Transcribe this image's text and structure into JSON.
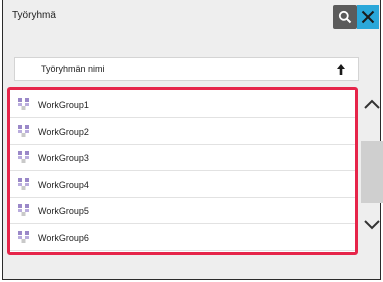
{
  "title": "Työryhmä",
  "sort_column_label": "Työryhmän nimi",
  "workgroups": [
    "WorkGroup1",
    "WorkGroup2",
    "WorkGroup3",
    "WorkGroup4",
    "WorkGroup5",
    "WorkGroup6"
  ],
  "colors": {
    "accent": "#e6254a",
    "close": "#2aa7d9",
    "search": "#5b5b5b"
  },
  "icons": {
    "search": "search-icon",
    "close": "close-icon",
    "sort": "sort-up-arrow-icon",
    "workgroup": "workgroup-icon",
    "scroll_up": "chevron-up-icon",
    "scroll_down": "chevron-down-icon"
  }
}
